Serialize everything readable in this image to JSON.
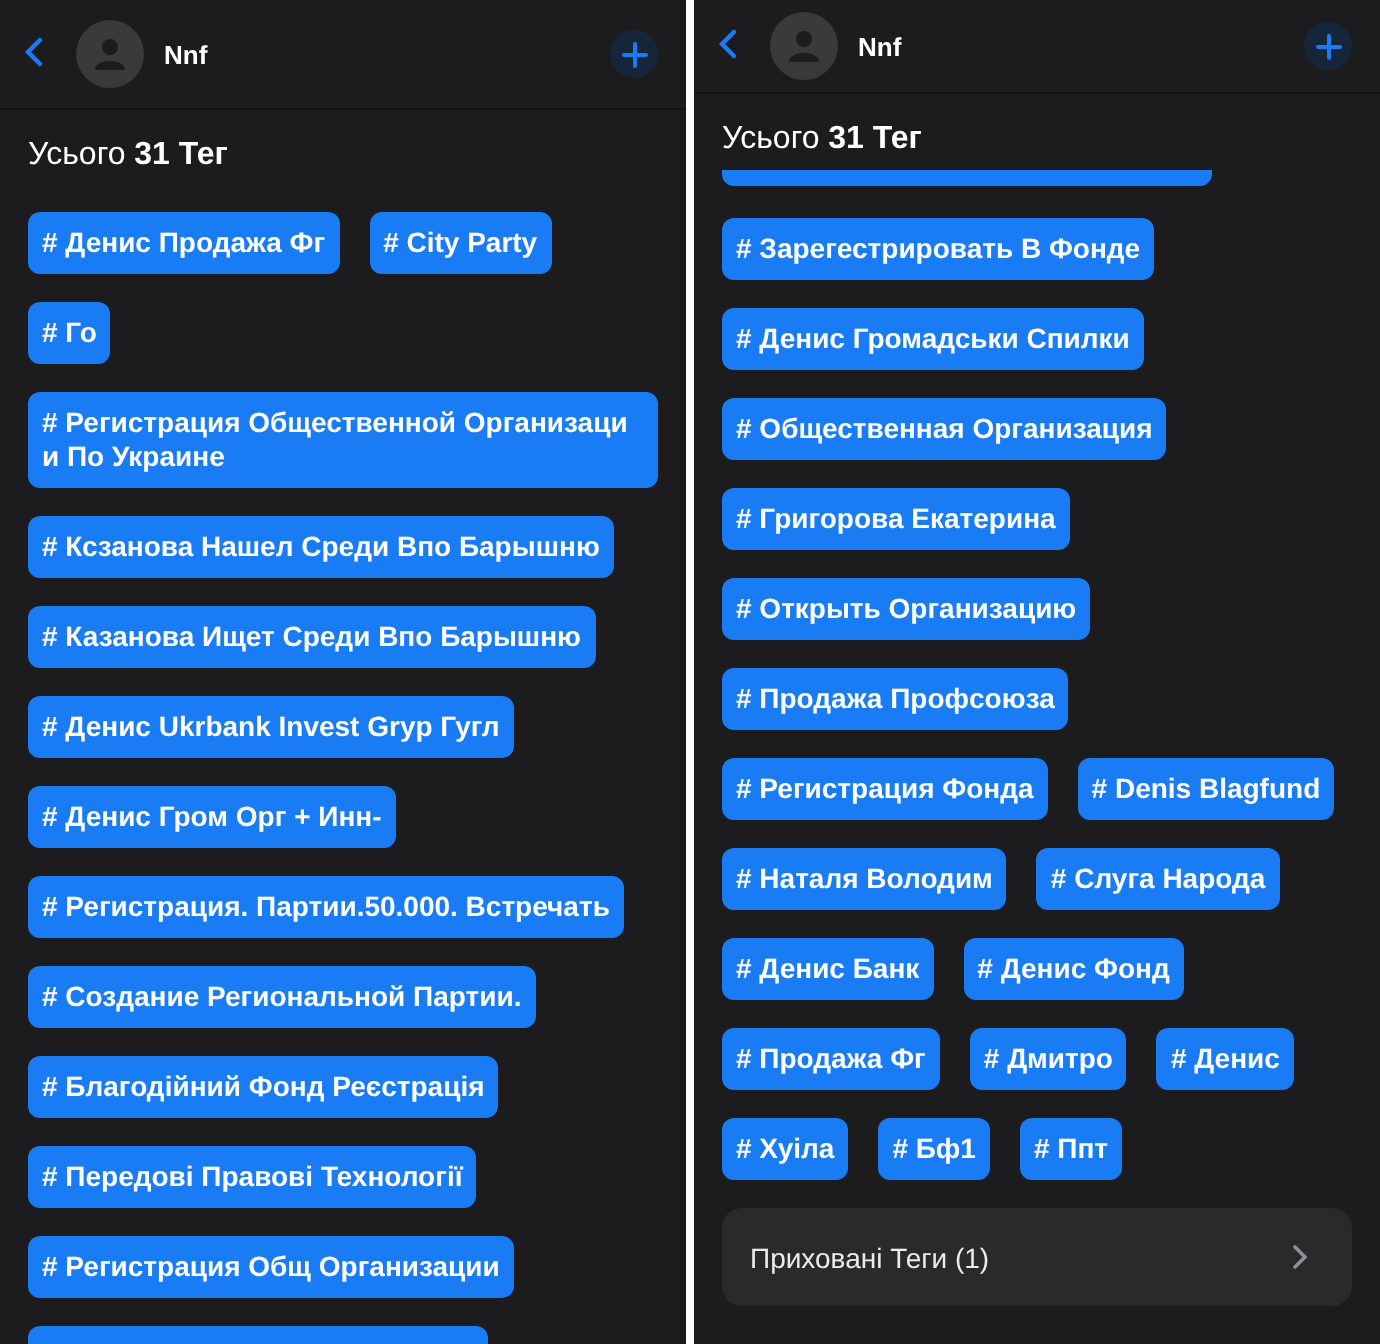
{
  "panels": [
    {
      "header": {
        "name": "Nnf"
      },
      "title": "Усього **31 Тег**",
      "clipped_top": false,
      "clipped_bottom": true,
      "tags": [
        {
          "label": "# Денис Продажа Фг"
        },
        {
          "label": "# City Party"
        },
        {
          "label": "# Го"
        },
        {
          "label": "# Регистрация Общественной Организаци и По Украине"
        },
        {
          "label": "# Ксзанова Нашел Среди Впо Барышню"
        },
        {
          "label": "# Казанова Ищет Среди Впо Барышню"
        },
        {
          "label": "# Денис Ukrbank Invest Gryp Гугл"
        },
        {
          "label": "# Денис Гром Орг + Инн-"
        },
        {
          "label": "# Регистрация. Партии.50.000. Встречать"
        },
        {
          "label": "# Создание Региональной Партии."
        },
        {
          "label": "# Благодійний Фонд Реєстрація"
        },
        {
          "label": "# Передові Правові Технології"
        },
        {
          "label": "# Регистрация Общ Организации"
        }
      ]
    },
    {
      "header": {
        "name": "Nnf"
      },
      "title": "Усього **31 Тег**",
      "clipped_top": true,
      "clipped_bottom": false,
      "tags": [
        {
          "label": "# Зарегестрировать В Фонде"
        },
        {
          "label": "# Денис Громадськи Спилки"
        },
        {
          "label": "# Общественная Организация"
        },
        {
          "label": "# Григорова Екатерина"
        },
        {
          "label": "# Открыть Организацию"
        },
        {
          "label": "# Продажа Профсоюза"
        },
        {
          "label": "# Регистрация Фонда"
        },
        {
          "label": "# Denis Blagfund"
        },
        {
          "label": "# Наталя Володим"
        },
        {
          "label": "# Слуга Народа"
        },
        {
          "label": "# Денис Банк"
        },
        {
          "label": "# Денис Фонд"
        },
        {
          "label": "# Продажа Фг"
        },
        {
          "label": "# Дмитро"
        },
        {
          "label": "# Денис"
        },
        {
          "label": "# Хуіла"
        },
        {
          "label": "# Бф1"
        },
        {
          "label": "# Ппт"
        }
      ],
      "hidden_tags": {
        "label": "Приховані Теги (1)"
      }
    }
  ]
}
